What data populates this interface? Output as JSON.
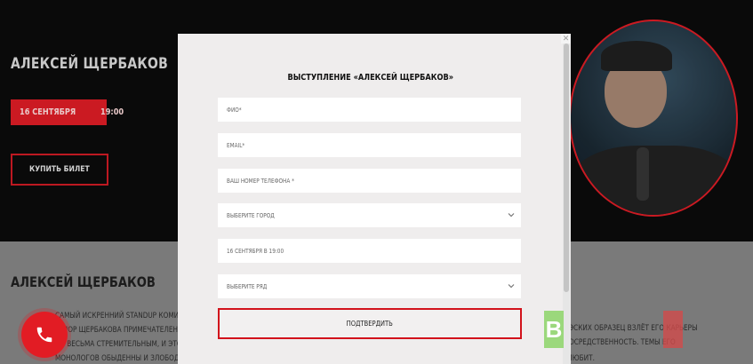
{
  "hero": {
    "title": "АЛЕКСЕЙ ЩЕРБАКОВ",
    "date": "16 СЕНТЯБРЯ",
    "time": "19:00",
    "buy_label": "КУПИТЬ БИЛЕТ",
    "photo_icon": "performer-photo"
  },
  "about": {
    "title": "АЛЕКСЕЙ ЩЕРБАКОВ",
    "lines": [
      "САМЫЙ ИСКРЕННИЙ STANDUP КОМИК —",
      "ЮМОР ЩЕРБАКОВА ПРИМЕЧАТЕЛЕН. ПРО",
      "ЫТ ВЕСЬМА СТРЕМИТЕЛЬНЫМ, И ЭТО К",
      "МОНОЛОГОВ ОБЫДЕННЫ И ЗЛОБОДНЕВНЫ — ШУТКИ ПРО БОМЖЕЙ, БАБОК, ВЕЙПЕРОВ И ВСЁ ТО ИСКУССТВЕННОЕ И НЕНАСТОЯЩЕЕ, ЧТО ОН ТАК НЕ ЛЮБИТ."
    ],
    "right_lines": [
      "ЭСКИХ ОБРАЗЕЦ ВЗЛЁТ ЕГО КАРЬЕРЫ",
      "ОСРЕДСТВЕННОСТЬ. ТЕМЫ ЕГО"
    ]
  },
  "modal": {
    "title": "ВЫСТУПЛЕНИЕ «АЛЕКСЕЙ ЩЕРБАКОВ»",
    "fields": {
      "name": "ФИО*",
      "email": "EMAIL*",
      "phone": "ВАШ НОМЕР ТЕЛЕФОНА *",
      "city": "ВЫБЕРИТЕ ГОРОД",
      "datetime": "16 СЕНТЯБРЯ В 19:00",
      "row": "ВЫБЕРИТЕ РЯД"
    },
    "submit_label": "ПОДТВЕРДИТЬ"
  },
  "widgets": {
    "call_icon": "phone-icon",
    "green_widget_text": "В"
  },
  "colors": {
    "accent": "#d2121b",
    "modal_bg": "#efeded",
    "page_bg": "#000000",
    "about_bg": "#7a7a7a"
  }
}
